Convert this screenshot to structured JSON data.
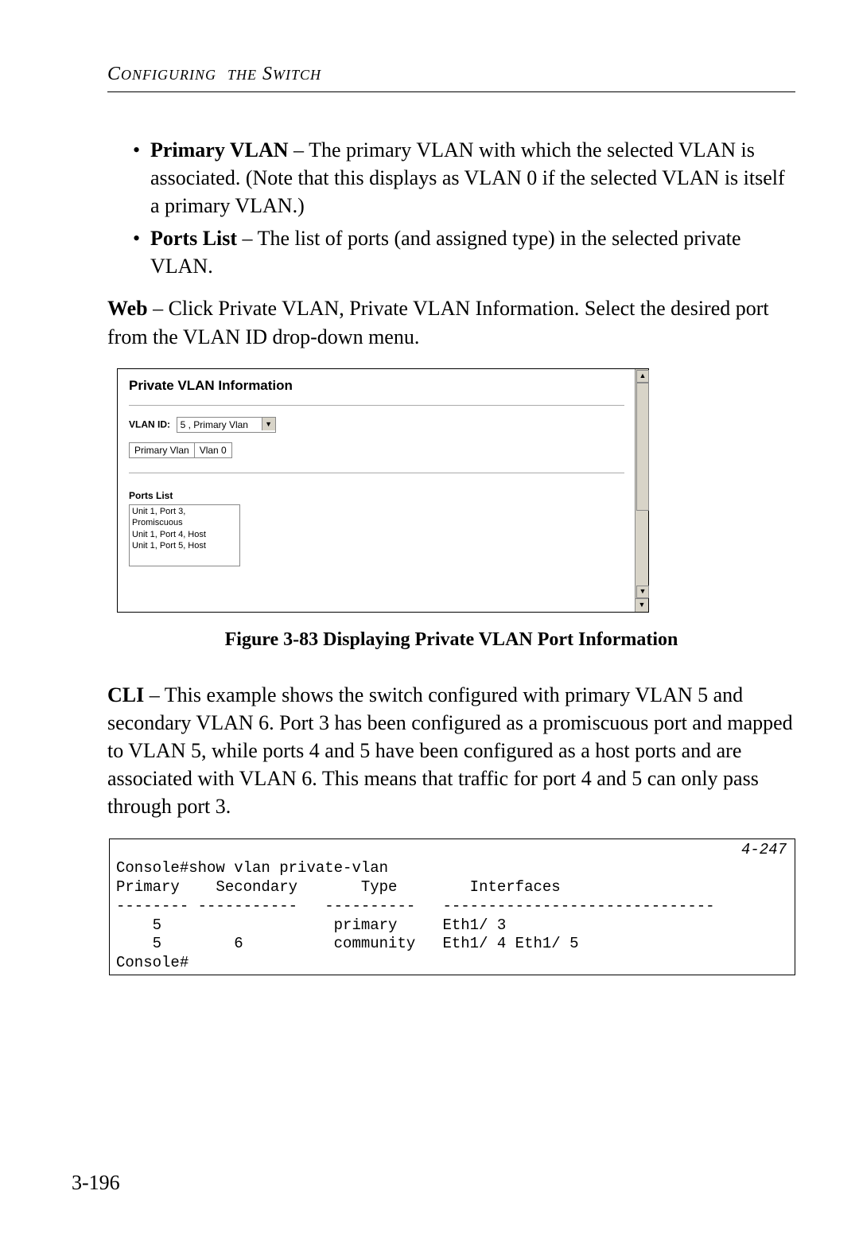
{
  "header": {
    "running_head": "Configuring the Switch"
  },
  "bullets": [
    {
      "term": "Primary VLAN",
      "text": " – The primary VLAN with which the selected VLAN is associated. (Note that this displays as VLAN 0 if the selected VLAN is itself a primary VLAN.)"
    },
    {
      "term": "Ports List",
      "text": " – The list of ports (and assigned type) in the selected private VLAN."
    }
  ],
  "web_para": {
    "lead": "Web",
    "rest": " – Click Private VLAN, Private VLAN Information. Select the desired port from the VLAN ID drop-down menu."
  },
  "screenshot": {
    "title": "Private VLAN Information",
    "vlan_id_label": "VLAN ID:",
    "vlan_id_value": "5 , Primary Vlan",
    "primary_label": "Primary Vlan",
    "primary_value": "Vlan 0",
    "ports_list_label": "Ports List",
    "ports": [
      "Unit 1, Port 3, Promiscuous",
      "Unit 1, Port 4, Host",
      "Unit 1, Port 5, Host"
    ],
    "scroll_up": "▲",
    "scroll_down": "▼",
    "dd_arrow": "▼"
  },
  "figure_caption": "Figure 3-83   Displaying Private VLAN Port Information",
  "cli_para": {
    "lead": "CLI",
    "rest": " – This example shows the switch configured with primary VLAN 5 and secondary VLAN 6. Port 3 has been configured as a promiscuous port and mapped to VLAN 5, while ports 4 and 5 have been configured as a host ports and are associated with VLAN 6. This means that traffic for port 4 and 5 can only pass through port 3."
  },
  "cli": {
    "ref": "4-247",
    "line1": "Console#show vlan private-vlan",
    "line2": "Primary    Secondary       Type        Interfaces",
    "line3": "-------- -----------   ----------   ------------------------------",
    "line4": "    5                   primary     Eth1/ 3",
    "line5": "    5        6          community   Eth1/ 4 Eth1/ 5",
    "line6": "Console#"
  },
  "page_number": "3-196"
}
